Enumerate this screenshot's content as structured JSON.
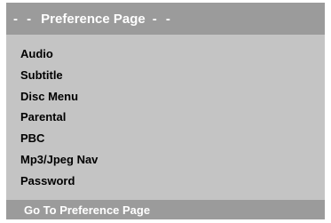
{
  "header": {
    "title_prefix": "- -",
    "title": "Preference Page",
    "title_suffix": "- -"
  },
  "menu": {
    "items": [
      {
        "label": "Audio"
      },
      {
        "label": "Subtitle"
      },
      {
        "label": "Disc Menu"
      },
      {
        "label": "Parental"
      },
      {
        "label": "PBC"
      },
      {
        "label": "Mp3/Jpeg Nav"
      },
      {
        "label": "Password"
      }
    ]
  },
  "footer": {
    "hint": "Go To Preference Page"
  },
  "colors": {
    "panel_background": "#c4c4c4",
    "bar_background": "#9b9b9b",
    "bar_text": "#ffffff",
    "item_text": "#000000"
  }
}
